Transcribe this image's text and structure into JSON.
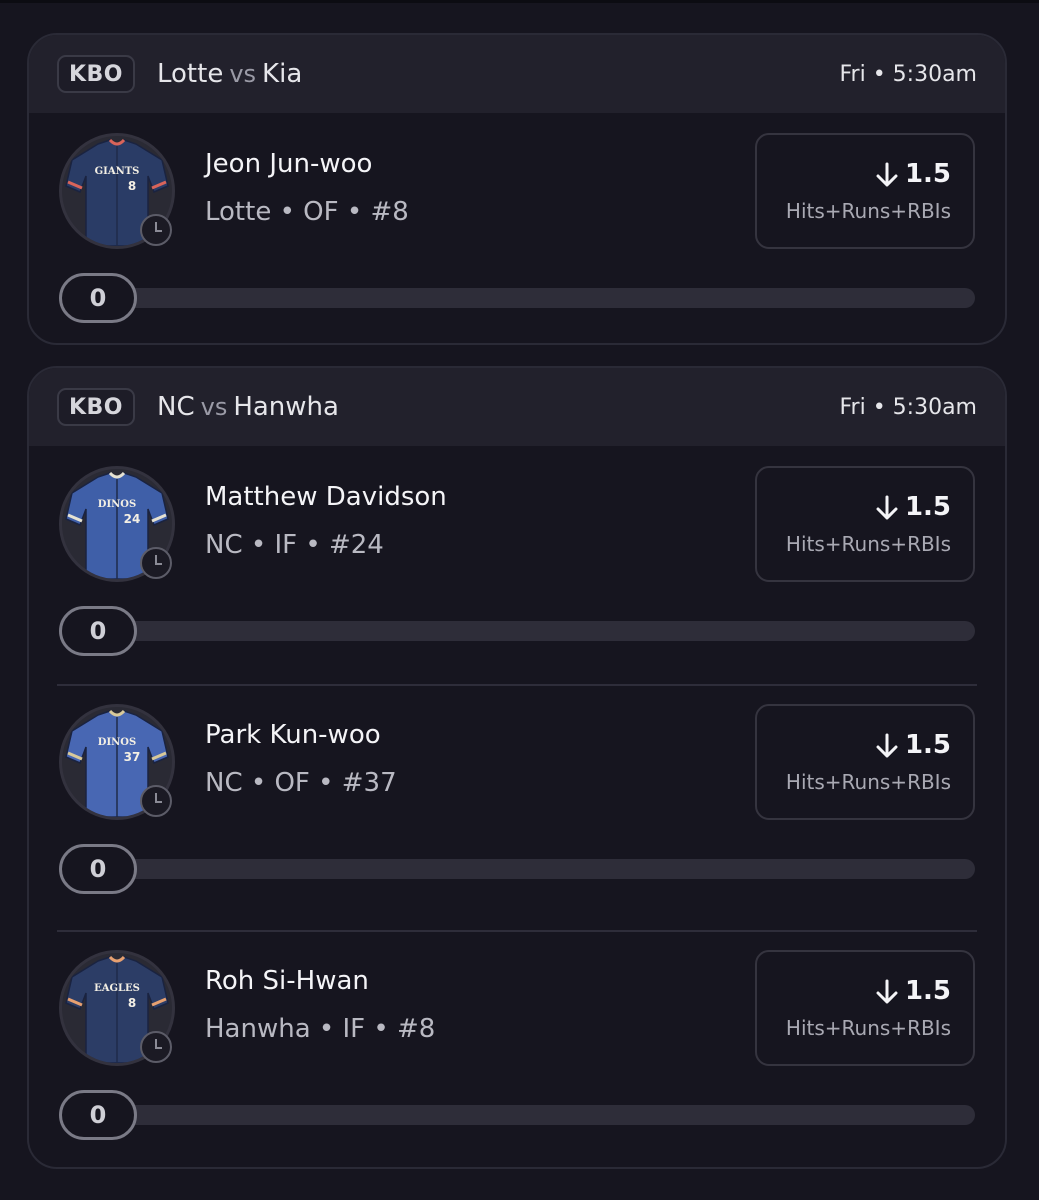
{
  "games": [
    {
      "league": "KBO",
      "team_home": "Lotte",
      "vs_label": "vs",
      "team_away": "Kia",
      "time": "Fri • 5:30am",
      "players": [
        {
          "name": "Jeon Jun-woo",
          "meta": "Lotte • OF • #8",
          "jersey_text": "GIANTS",
          "jersey_number": "8",
          "jersey_color": "#2a3c66",
          "jersey_trim": "#d9645a",
          "line_value": "1.5",
          "stat": "Hits+Runs+RBIs",
          "progress": "0",
          "progress_fraction": 0
        }
      ]
    },
    {
      "league": "KBO",
      "team_home": "NC",
      "vs_label": "vs",
      "team_away": "Hanwha",
      "time": "Fri • 5:30am",
      "players": [
        {
          "name": "Matthew Davidson",
          "meta": "NC • IF • #24",
          "jersey_text": "DINOS",
          "jersey_number": "24",
          "jersey_color": "#3f5fa8",
          "jersey_trim": "#e6e2d2",
          "line_value": "1.5",
          "stat": "Hits+Runs+RBIs",
          "progress": "0",
          "progress_fraction": 0
        },
        {
          "name": "Park Kun-woo",
          "meta": "NC • OF • #37",
          "jersey_text": "DINOS",
          "jersey_number": "37",
          "jersey_color": "#4867b3",
          "jersey_trim": "#d8c99a",
          "line_value": "1.5",
          "stat": "Hits+Runs+RBIs",
          "progress": "0",
          "progress_fraction": 0
        },
        {
          "name": "Roh Si-Hwan",
          "meta": "Hanwha • IF • #8",
          "jersey_text": "EAGLES",
          "jersey_number": "8",
          "jersey_color": "#2c3d66",
          "jersey_trim": "#e7a070",
          "line_value": "1.5",
          "stat": "Hits+Runs+RBIs",
          "progress": "0",
          "progress_fraction": 0
        }
      ]
    }
  ],
  "icons": {
    "league_badge": "kbo-badge",
    "line_direction": "arrow-down-icon",
    "status": "clock-icon"
  },
  "colors": {
    "background": "#16151f",
    "header": "#22212c",
    "track": "#2e2d39",
    "border": "#2a2a36"
  }
}
